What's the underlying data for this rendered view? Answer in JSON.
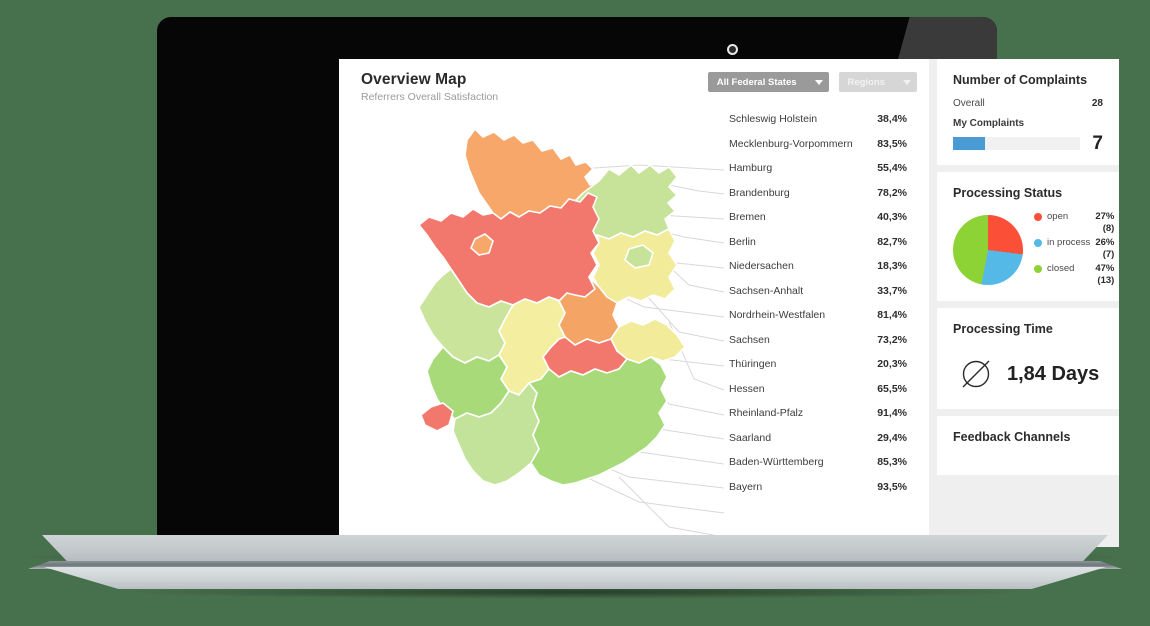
{
  "header": {
    "title": "Overview Map",
    "subtitle": "Referrers Overall Satisfaction"
  },
  "filters": {
    "federal_states": "All Federal States",
    "regions": "Regions"
  },
  "map": {
    "states": [
      {
        "name": "Schleswig Holstein",
        "value": "38,4%",
        "color": "#f8a76a"
      },
      {
        "name": "Mecklenburg-Vorpommern",
        "value": "83,5%",
        "color": "#c7e39a"
      },
      {
        "name": "Hamburg",
        "value": "55,4%",
        "color": "#f6e98f"
      },
      {
        "name": "Brandenburg",
        "value": "78,2%",
        "color": "#f2eb9a"
      },
      {
        "name": "Bremen",
        "value": "40,3%",
        "color": "#f8a76a"
      },
      {
        "name": "Berlin",
        "value": "82,7%",
        "color": "#c7e39a"
      },
      {
        "name": "Niedersachen",
        "value": "18,3%",
        "color": "#f2776c"
      },
      {
        "name": "Sachsen-Anhalt",
        "value": "33,7%",
        "color": "#f4a464"
      },
      {
        "name": "Nordrhein-Westfalen",
        "value": "81,4%",
        "color": "#cbe49c"
      },
      {
        "name": "Sachsen",
        "value": "73,2%",
        "color": "#f2eb9a"
      },
      {
        "name": "Thüringen",
        "value": "20,3%",
        "color": "#f2776c"
      },
      {
        "name": "Hessen",
        "value": "65,5%",
        "color": "#f4efa0"
      },
      {
        "name": "Rheinland-Pfalz",
        "value": "91,4%",
        "color": "#a8da7a"
      },
      {
        "name": "Saarland",
        "value": "29,4%",
        "color": "#f2776c"
      },
      {
        "name": "Baden-Württemberg",
        "value": "85,3%",
        "color": "#c3e39a"
      },
      {
        "name": "Bayern",
        "value": "93,5%",
        "color": "#a8da7a"
      }
    ]
  },
  "complaints": {
    "title": "Number of Complaints",
    "overall_label": "Overall",
    "overall_value": "28",
    "mine_label": "My Complaints",
    "mine_value": "7",
    "mine_percent": 25,
    "bar_color": "#4a9ad4"
  },
  "processing_status": {
    "title": "Processing Status",
    "chart_data": {
      "type": "pie",
      "title": "Processing Status",
      "categories": [
        "open",
        "in process",
        "closed"
      ],
      "values": [
        27,
        26,
        47
      ],
      "counts": [
        8,
        7,
        13
      ],
      "colors": [
        "#fb4f37",
        "#55b9e8",
        "#8dd336"
      ],
      "legend_position": "right",
      "start_angle": 0
    },
    "legend": [
      {
        "label": "open",
        "pct": "27%",
        "count": "(8)",
        "color": "#fb4f37"
      },
      {
        "label": "in process",
        "pct": "26%",
        "count": "(7)",
        "color": "#55b9e8"
      },
      {
        "label": "closed",
        "pct": "47%",
        "count": "(13)",
        "color": "#8dd336"
      }
    ]
  },
  "processing_time": {
    "title": "Processing Time",
    "symbol": "average-diameter-icon",
    "value": "1,84 Days"
  },
  "feedback": {
    "title": "Feedback Channels"
  }
}
